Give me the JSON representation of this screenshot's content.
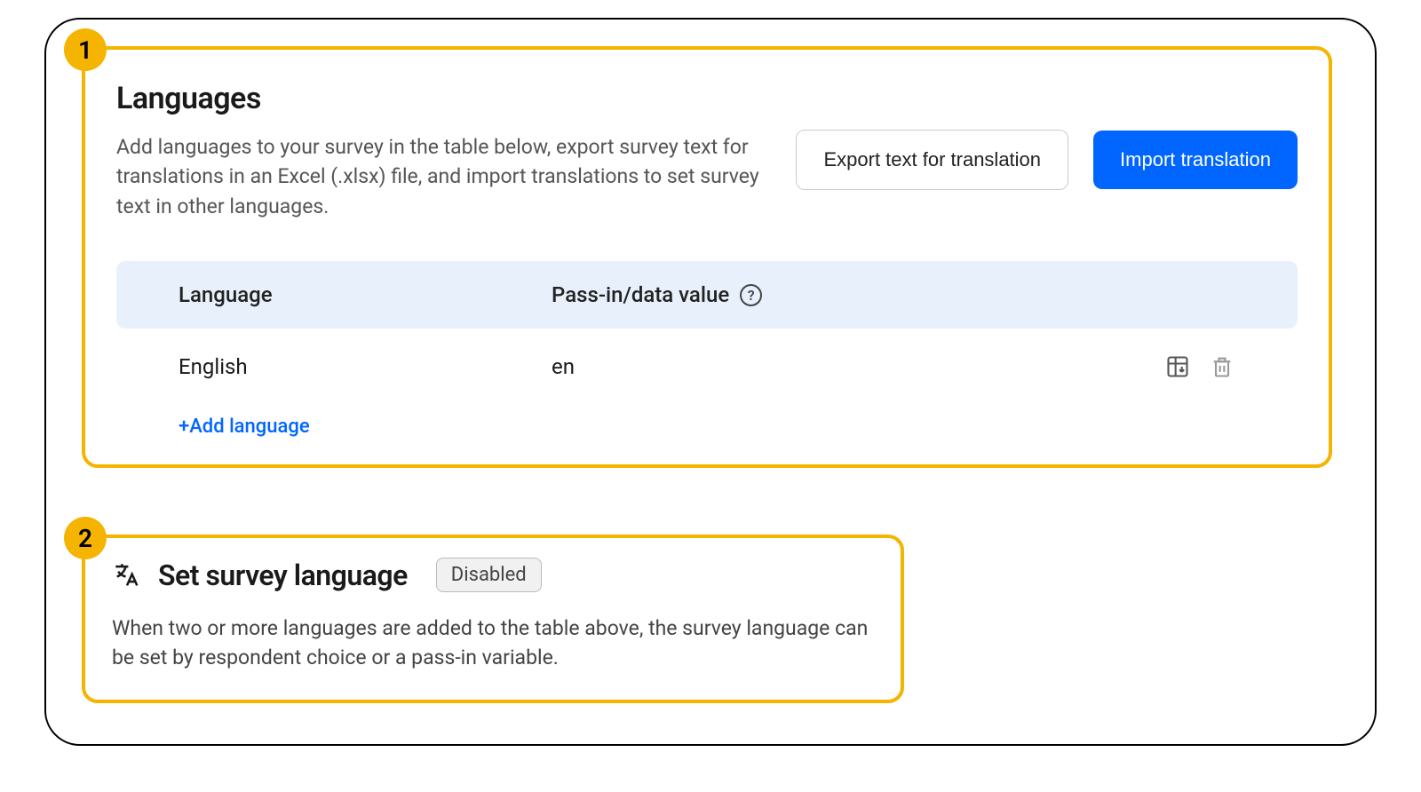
{
  "callouts": {
    "one": "1",
    "two": "2"
  },
  "section1": {
    "title": "Languages",
    "description": "Add languages to your survey in the table below, export survey text for translations in an Excel (.xlsx) file, and import translations to set survey text in other languages.",
    "export_btn": "Export text for translation",
    "import_btn": "Import translation",
    "header_language": "Language",
    "header_value": "Pass-in/data value",
    "row_language": "English",
    "row_value": "en",
    "add_language": "+Add language"
  },
  "section2": {
    "title": "Set survey language",
    "badge": "Disabled",
    "description": "When two or more languages are added to the table above, the survey language can be set by respondent choice or a pass-in variable."
  }
}
